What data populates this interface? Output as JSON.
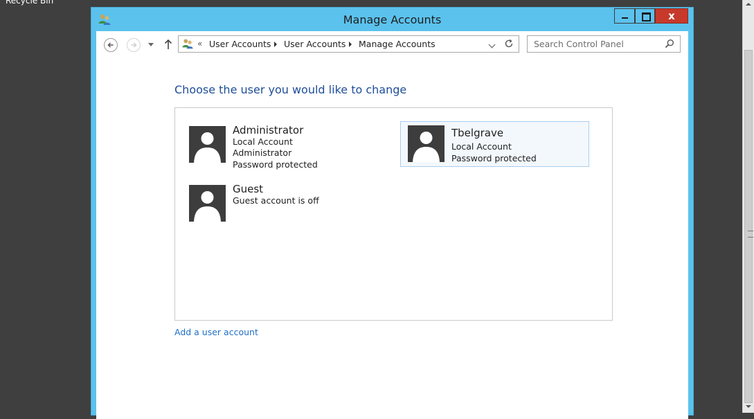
{
  "desktop": {
    "icon_label": "Recycle Bin"
  },
  "window": {
    "title": "Manage Accounts",
    "close_label": "x"
  },
  "nav": {
    "overflow": "«",
    "breadcrumbs": [
      "User Accounts",
      "User Accounts",
      "Manage Accounts"
    ]
  },
  "search": {
    "placeholder": "Search Control Panel"
  },
  "main": {
    "heading": "Choose the user you would like to change",
    "accounts": [
      {
        "name": "Administrator",
        "details": [
          "Local Account",
          "Administrator",
          "Password protected"
        ],
        "selected": false
      },
      {
        "name": "Guest",
        "details": [
          "Guest account is off"
        ],
        "selected": false
      },
      {
        "name": "Tbelgrave",
        "details": [
          "Local Account",
          "Password protected"
        ],
        "selected": true
      }
    ],
    "add_account_link": "Add a user account"
  },
  "colors": {
    "window_frame": "#5bc2ed",
    "heading": "#1e4d99",
    "link": "#1e6ec5",
    "close_button": "#c7392b",
    "selected_tile": "#f3f8fd",
    "avatar": "#3d3d3d"
  },
  "icons": [
    "user-accounts-icon",
    "back-arrow-icon",
    "forward-arrow-icon",
    "up-arrow-icon",
    "refresh-icon",
    "search-icon",
    "user-avatar-icon"
  ]
}
